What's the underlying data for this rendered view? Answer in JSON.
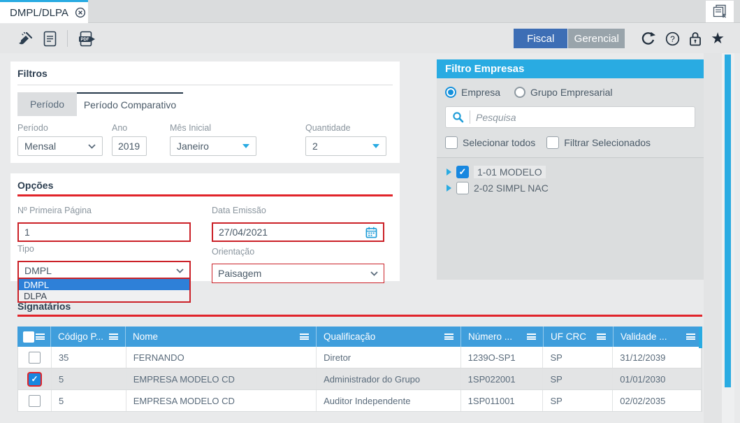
{
  "window": {
    "tab_title": "DMPL/DLPA"
  },
  "toolbar": {
    "fiscal_label": "Fiscal",
    "gerencial_label": "Gerencial"
  },
  "filtros": {
    "title": "Filtros",
    "tabs": [
      {
        "label": "Período"
      },
      {
        "label": "Período Comparativo"
      }
    ],
    "periodo": {
      "label": "Período",
      "value": "Mensal"
    },
    "ano": {
      "label": "Ano",
      "value": "2019"
    },
    "mes_inicial": {
      "label": "Mês Inicial",
      "value": "Janeiro"
    },
    "quantidade": {
      "label": "Quantidade",
      "value": "2"
    }
  },
  "opcoes": {
    "title": "Opções",
    "primeira_pagina": {
      "label": "Nº Primeira Página",
      "value": "1"
    },
    "data_emissao": {
      "label": "Data Emissão",
      "value": "27/04/2021"
    },
    "tipo": {
      "label": "Tipo",
      "value": "DMPL",
      "options": [
        "DMPL",
        "DLPA"
      ],
      "open": true,
      "highlighted_option": "DMPL"
    },
    "orientacao": {
      "label": "Orientação",
      "value": "Paisagem"
    }
  },
  "filtro_empresas": {
    "title": "Filtro Empresas",
    "radio_empresa_label": "Empresa",
    "radio_grupo_label": "Grupo Empresarial",
    "search_placeholder": "Pesquisa",
    "selecionar_todos_label": "Selecionar todos",
    "filtrar_selecionados_label": "Filtrar Selecionados",
    "empresas": [
      {
        "label": "1-01 MODELO",
        "checked": true
      },
      {
        "label": "2-02 SIMPL NAC",
        "checked": false
      }
    ]
  },
  "signatarios": {
    "title": "Signatários",
    "columns": [
      "Código P...",
      "Nome",
      "Qualificação",
      "Número ...",
      "UF CRC",
      "Validade ..."
    ],
    "rows": [
      {
        "checked": false,
        "selected": false,
        "codigo": "35",
        "nome": "FERNANDO",
        "qualificacao": "Diretor",
        "numero": "1239O-SP1",
        "uf_crc": "SP",
        "validade": "31/12/2039"
      },
      {
        "checked": true,
        "selected": true,
        "codigo": "5",
        "nome": "EMPRESA MODELO CD",
        "qualificacao": "Administrador do Grupo",
        "numero": "1SP022001",
        "uf_crc": "SP",
        "validade": "01/01/2030"
      },
      {
        "checked": false,
        "selected": false,
        "codigo": "5",
        "nome": "EMPRESA MODELO CD",
        "qualificacao": "Auditor Independente",
        "numero": "1SP011001",
        "uf_crc": "SP",
        "validade": "02/02/2035"
      }
    ]
  },
  "icons": {
    "tab_close": "circle-x",
    "close_all_documents": "stacked-documents-x",
    "clean": "broom",
    "report": "document",
    "export_pdf": "pdf-document-arrow",
    "refresh": "circular-arrow",
    "help": "question-circle",
    "lock": "padlock",
    "favorite": "star",
    "search": "magnifier",
    "calendar": "calendar",
    "column_menu": "hamburger"
  },
  "colors": {
    "accent_blue": "#29ABE2",
    "table_header_blue": "#3F9EDC",
    "fiscal_button_blue": "#3D6EB5",
    "gerencial_button_gray": "#99A4AB",
    "alert_red": "#E1242A",
    "selection_blue": "#2E80D8",
    "checkbox_blue": "#1787E0"
  }
}
